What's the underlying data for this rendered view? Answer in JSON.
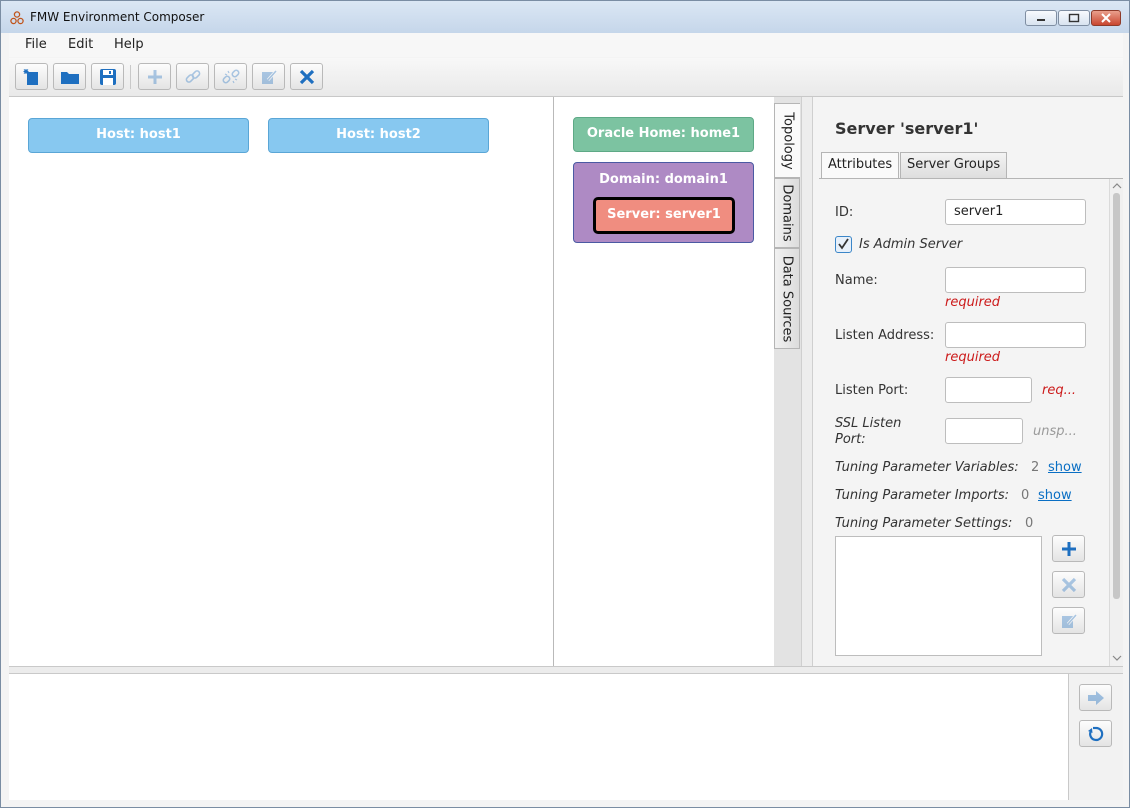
{
  "window": {
    "title": "FMW Environment Composer"
  },
  "menu": {
    "file": "File",
    "edit": "Edit",
    "help": "Help"
  },
  "hosts": [
    {
      "label": "Host: host1"
    },
    {
      "label": "Host: host2"
    }
  ],
  "topology": {
    "oracle_home": "Oracle Home: home1",
    "domain": "Domain: domain1",
    "server": "Server: server1"
  },
  "side_tabs": {
    "topology": "Topology",
    "domains": "Domains",
    "data_sources": "Data Sources"
  },
  "details": {
    "title": "Server 'server1'",
    "tabs": {
      "attributes": "Attributes",
      "server_groups": "Server Groups"
    },
    "id_label": "ID:",
    "id_value": "server1",
    "is_admin_label": "Is Admin Server",
    "is_admin_checked": true,
    "name_label": "Name:",
    "name_hint": "required",
    "listen_address_label": "Listen Address:",
    "listen_address_hint": "required",
    "listen_port_label": "Listen Port:",
    "listen_port_hint": "req...",
    "ssl_label_line1": "SSL Listen",
    "ssl_label_line2": "Port:",
    "ssl_hint": "unsp...",
    "tuning_variables_label": "Tuning Parameter Variables:",
    "tuning_variables_count": "2",
    "tuning_imports_label": "Tuning Parameter Imports:",
    "tuning_imports_count": "0",
    "tuning_settings_label": "Tuning Parameter Settings:",
    "tuning_settings_count": "0",
    "show_link": "show"
  },
  "colors": {
    "host": "#87c8f0",
    "oracle_home": "#7cc3a1",
    "domain": "#ae8ac4",
    "server": "#f08d80",
    "accent": "#0a6fc4",
    "required": "#cc1b1b"
  }
}
